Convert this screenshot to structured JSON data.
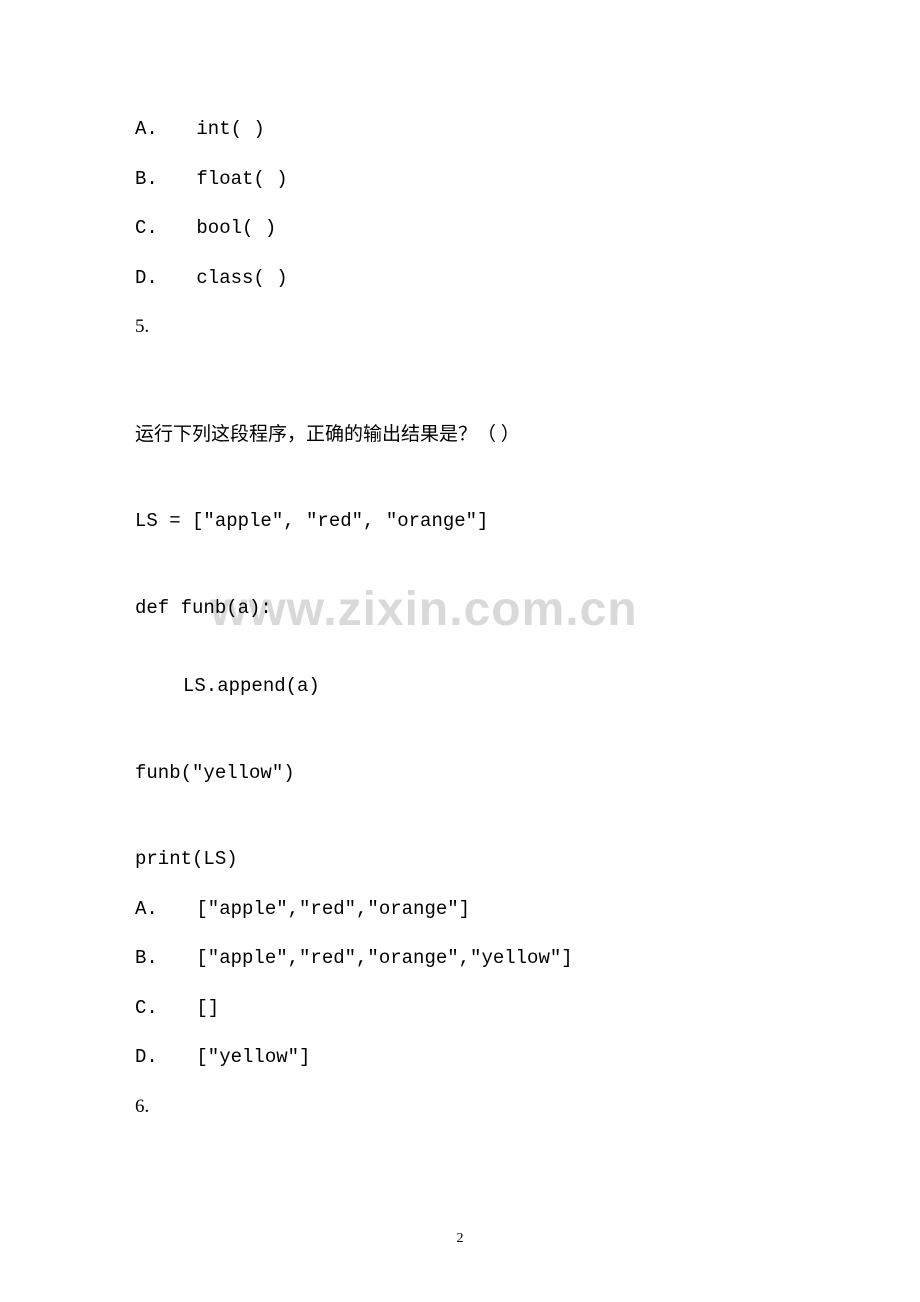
{
  "options4": {
    "a": {
      "label": "A.",
      "value": "int( )"
    },
    "b": {
      "label": "B.",
      "value": "float( )"
    },
    "c": {
      "label": "C.",
      "value": "bool( )"
    },
    "d": {
      "label": "D.",
      "value": "class( )"
    }
  },
  "question5": {
    "number": "5.",
    "text": "运行下列这段程序，正确的输出结果是？（  ）",
    "code": {
      "line1": "LS = [\"apple\", \"red\", \"orange\"]",
      "line2": "def funb(a):",
      "line3": "LS.append(a)",
      "line4": "funb(\"yellow\")",
      "line5": "print(LS)"
    },
    "options": {
      "a": {
        "label": "A.",
        "value": "[\"apple\",\"red\",\"orange\"]"
      },
      "b": {
        "label": "B.",
        "value": "[\"apple\",\"red\",\"orange\",\"yellow\"]"
      },
      "c": {
        "label": "C.",
        "value": "[]"
      },
      "d": {
        "label": "D.",
        "value": "[\"yellow\"]"
      }
    }
  },
  "question6": {
    "number": "6."
  },
  "watermark": "www.zixin.com.cn",
  "pageNumber": "2"
}
